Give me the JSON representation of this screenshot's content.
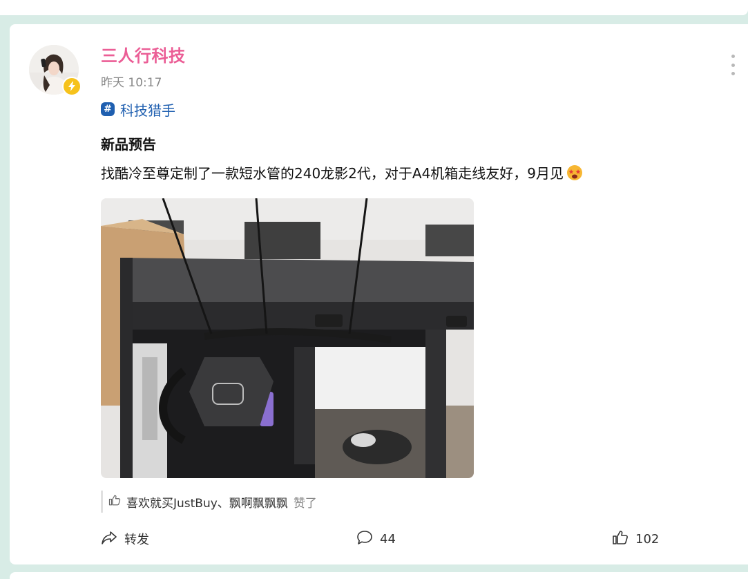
{
  "post": {
    "author": "三人行科技",
    "time": "昨天 10:17",
    "topic": "科技猎手",
    "title": "新品预告",
    "body": "找酷冷至尊定制了一款短水管的240龙影2代，对于A4机箱走线友好，9月见"
  },
  "likes": {
    "names": "喜欢就买JustBuy、飘啊飘飘飘",
    "suffix": "赞了"
  },
  "actions": {
    "repost_label": "转发",
    "comment_count": "44",
    "like_count": "102"
  },
  "icons": {
    "badge": "lightning-icon",
    "topic": "hashtag-icon",
    "more": "more-vertical-icon",
    "emoji": "star-struck-emoji-icon",
    "likes": "thumbs-up-icon",
    "repost": "share-arrow-icon",
    "comment": "comment-bubble-icon",
    "like": "thumbs-up-icon"
  },
  "colors": {
    "author": "#eb5e96",
    "topic": "#1f5fb0",
    "badge": "#f6c21c",
    "background": "#d8ece6"
  }
}
